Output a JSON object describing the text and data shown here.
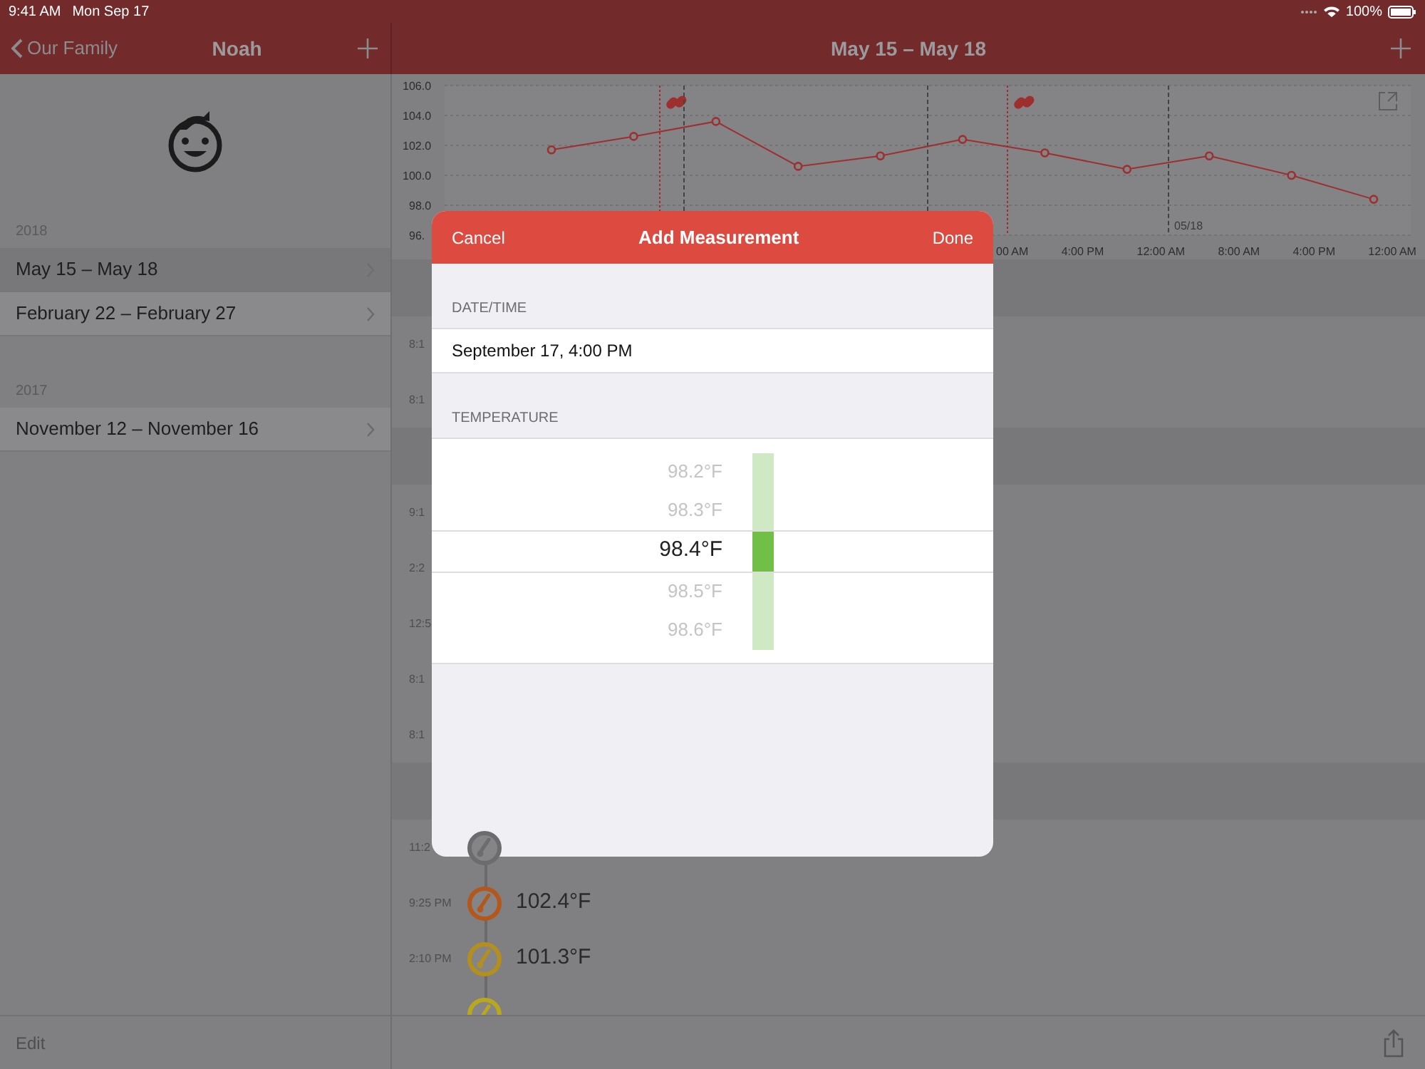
{
  "status_bar": {
    "time": "9:41 AM",
    "date": "Mon Sep 17",
    "battery": "100%"
  },
  "sidebar": {
    "back": "Our Family",
    "title": "Noah",
    "groups": [
      {
        "year": "2018",
        "items": [
          {
            "label": "May 15 – May 18",
            "selected": true
          },
          {
            "label": "February 22 – February 27",
            "selected": false
          }
        ]
      },
      {
        "year": "2017",
        "items": [
          {
            "label": "November 12 – November 16",
            "selected": false
          }
        ]
      }
    ],
    "edit": "Edit"
  },
  "detail": {
    "title": "May 15 – May 18",
    "chart_data": {
      "type": "line",
      "ylim": [
        96,
        106
      ],
      "yticks": [
        {
          "value": 106,
          "label": "106.0"
        },
        {
          "value": 104,
          "label": "104.0"
        },
        {
          "value": 102,
          "label": "102.0"
        },
        {
          "value": 100,
          "label": "100.0"
        },
        {
          "value": 98,
          "label": "98.0"
        },
        {
          "value": 96,
          "label": "96."
        }
      ],
      "categories": [
        null,
        null,
        null,
        null,
        null,
        null,
        null,
        null,
        null,
        null,
        null
      ],
      "grid": true,
      "series": [
        {
          "marker": "circle",
          "color": "#9e2f2f",
          "values": [
            101.7,
            102.6,
            103.6,
            100.6,
            101.3,
            102.4,
            101.5,
            100.4,
            101.3,
            100.0,
            98.4
          ]
        }
      ],
      "annotations": [
        "05/18"
      ]
    },
    "time_labels": [
      "00 AM",
      "4:00 PM",
      "12:00 AM",
      "8:00 AM",
      "4:00 PM",
      "12:00 AM"
    ],
    "timeline": [
      {
        "kind": "section"
      },
      {
        "kind": "reading",
        "time": "8:1"
      },
      {
        "kind": "reading",
        "time": "8:1"
      },
      {
        "kind": "section"
      },
      {
        "kind": "reading",
        "time": "9:1"
      },
      {
        "kind": "reading",
        "time": "2:2"
      },
      {
        "kind": "reading",
        "time": "12:5"
      },
      {
        "kind": "reading",
        "time": "8:1"
      },
      {
        "kind": "reading",
        "time": "8:1"
      },
      {
        "kind": "section"
      },
      {
        "kind": "reading",
        "time": "11:2",
        "color": "#6c6c6e"
      },
      {
        "kind": "reading",
        "time": "9:25 PM",
        "value": "102.4°F",
        "color": "#b4571b"
      },
      {
        "kind": "reading",
        "time": "2:10 PM",
        "value": "101.3°F",
        "color": "#b58f1c"
      },
      {
        "kind": "reading",
        "color": "#b9a81c"
      }
    ]
  },
  "dialog": {
    "cancel": "Cancel",
    "title": "Add Measurement",
    "done": "Done",
    "datetime_label": "DATE/TIME",
    "datetime": "September 17, 4:00 PM",
    "temperature_label": "TEMPERATURE",
    "options": [
      {
        "label": "98.2°F",
        "selected": false
      },
      {
        "label": "98.3°F",
        "selected": false
      },
      {
        "label": "98.4°F",
        "selected": true
      },
      {
        "label": "98.5°F",
        "selected": false
      },
      {
        "label": "98.6°F",
        "selected": false
      }
    ]
  }
}
